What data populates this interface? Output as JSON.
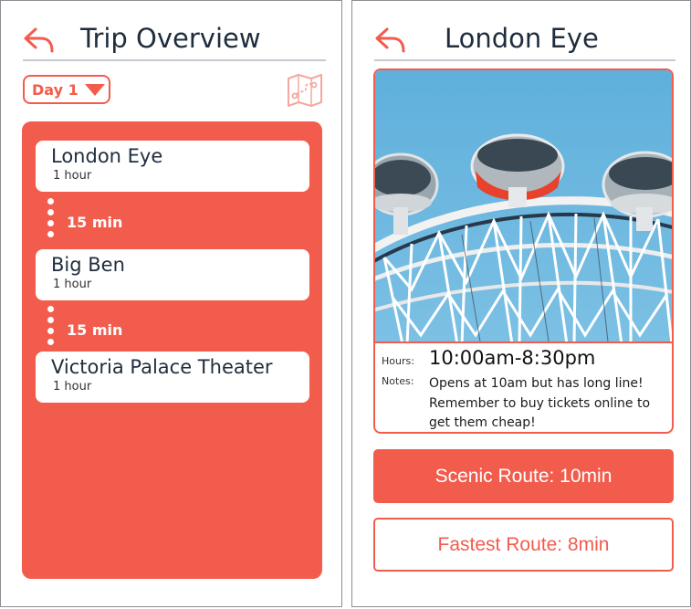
{
  "colors": {
    "accent": "#f25c4d",
    "text": "#1f2d3d",
    "sky": "#6cb4dc"
  },
  "overview": {
    "title": "Trip Overview",
    "back_icon": "back-arrow-icon",
    "day_selector": "Day 1",
    "map_icon": "map-route-icon",
    "stops": [
      {
        "name": "London Eye",
        "duration": "1 hour"
      },
      {
        "name": "Big Ben",
        "duration": "1 hour"
      },
      {
        "name": "Victoria Palace Theater",
        "duration": "1 hour"
      }
    ],
    "travel_times": [
      "15 min",
      "15 min"
    ]
  },
  "detail": {
    "title": "London Eye",
    "back_icon": "back-arrow-icon",
    "photo": "london-eye-photo",
    "hours_label": "Hours:",
    "hours": "10:00am-8:30pm",
    "notes_label": "Notes:",
    "notes": "Opens at 10am but has long line! Remember to buy tickets online to get them cheap!",
    "scenic_route": "Scenic Route: 10min",
    "fastest_route": "Fastest Route: 8min"
  }
}
